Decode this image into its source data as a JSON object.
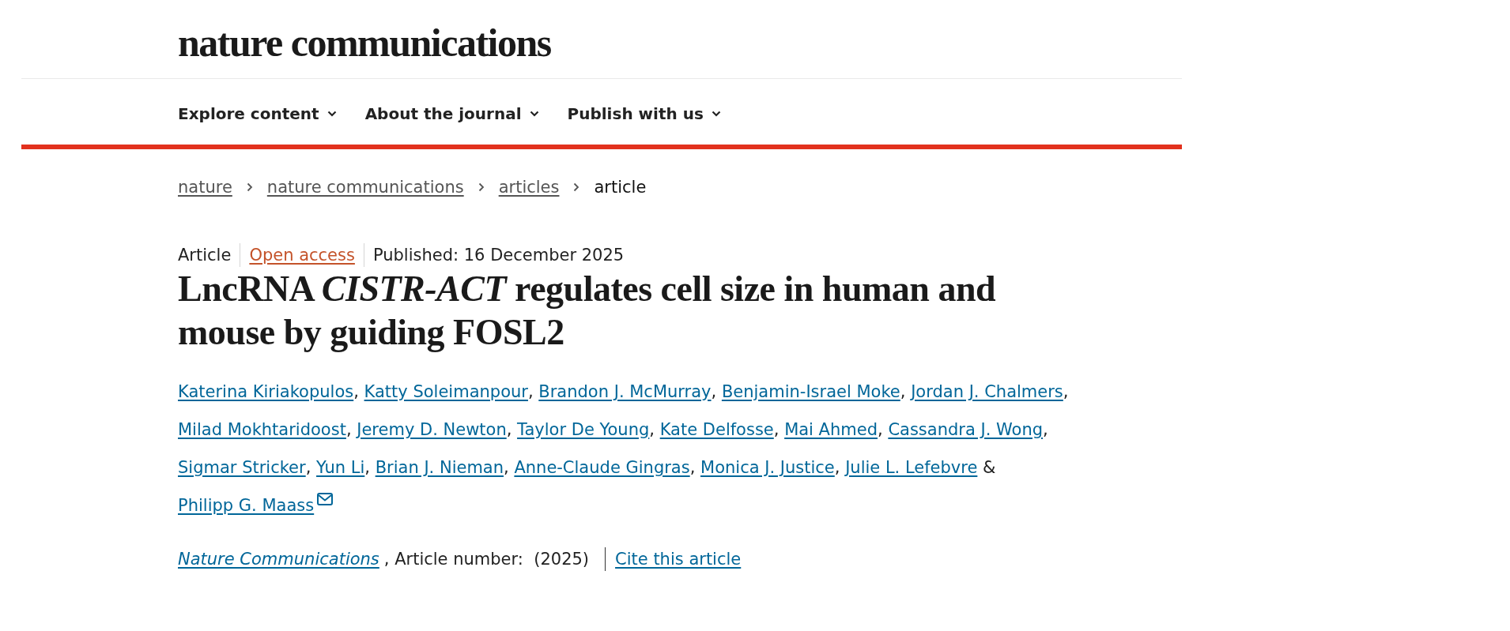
{
  "header": {
    "logo": "nature communications"
  },
  "nav": [
    {
      "label": "Explore content"
    },
    {
      "label": "About the journal"
    },
    {
      "label": "Publish with us"
    }
  ],
  "breadcrumb": [
    {
      "label": "nature",
      "current": false
    },
    {
      "label": "nature communications",
      "current": false
    },
    {
      "label": "articles",
      "current": false
    },
    {
      "label": "article",
      "current": true
    }
  ],
  "article": {
    "meta": [
      {
        "kind": "type",
        "text": "Article"
      },
      {
        "kind": "access",
        "text": "Open access"
      },
      {
        "kind": "date",
        "text": "Published: 16 December 2025"
      }
    ],
    "title": "LncRNA *CISTR-ACT* regulates cell size in human and mouse by guiding FOSL2",
    "authors": [
      {
        "name": "Katerina Kiriakopulos",
        "separator": ",",
        "corresponding": false
      },
      {
        "name": "Katty Soleimanpour",
        "separator": ",",
        "corresponding": false
      },
      {
        "name": "Brandon J. McMurray",
        "separator": ",",
        "corresponding": false
      },
      {
        "name": "Benjamin-Israel Moke",
        "separator": ",",
        "corresponding": false
      },
      {
        "name": "Jordan J. Chalmers",
        "separator": ",",
        "corresponding": false
      },
      {
        "name": "Milad Mokhtaridoost",
        "separator": ",",
        "corresponding": false
      },
      {
        "name": "Jeremy D. Newton",
        "separator": ",",
        "corresponding": false
      },
      {
        "name": "Taylor De Young",
        "separator": ",",
        "corresponding": false
      },
      {
        "name": "Kate Delfosse",
        "separator": ",",
        "corresponding": false
      },
      {
        "name": "Mai Ahmed",
        "separator": ",",
        "corresponding": false
      },
      {
        "name": "Cassandra J. Wong",
        "separator": ",",
        "corresponding": false
      },
      {
        "name": "Sigmar Stricker",
        "separator": ",",
        "corresponding": false
      },
      {
        "name": "Yun Li",
        "separator": ",",
        "corresponding": false
      },
      {
        "name": "Brian J. Nieman",
        "separator": ",",
        "corresponding": false
      },
      {
        "name": "Anne-Claude Gingras",
        "separator": ",",
        "corresponding": false
      },
      {
        "name": "Monica J. Justice",
        "separator": ",",
        "corresponding": false
      },
      {
        "name": "Julie L. Lefebvre",
        "separator": " &",
        "corresponding": false
      },
      {
        "name": "Philipp G. Maass",
        "corresponding": true
      }
    ],
    "citation": {
      "journal": "Nature Communications",
      "details": ", Article number:  (2025)",
      "cite_link": "Cite this article"
    }
  }
}
